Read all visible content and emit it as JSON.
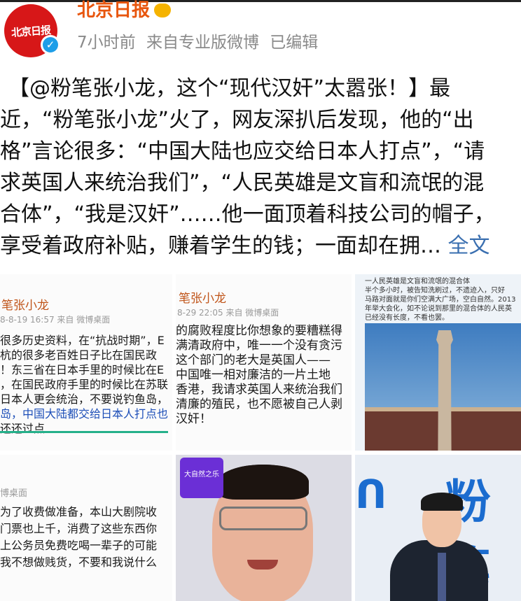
{
  "post": {
    "author": "北京日报",
    "avatar_text": "北京日报",
    "meta": "7小时前  来自专业版微博  已编辑",
    "verified_icon": "verified-check-icon",
    "lines": [
      "【@粉笔张小龙，这个“现代汉奸”太嚣张！】最",
      "近，“粉笔张小龙”火了，网友深扒后发现，他的“出",
      "格”言论很多：“中国大陆也应交给日本人打点”，“请",
      "求英国人来统治我们”，“人民英雄是文盲和流氓的混",
      "合体”，“我是汉奸”……他一面顶着科技公司的帽子，",
      "享受着政府补贴，赚着学生的钱；一面却在拥…"
    ],
    "expand_label": "全文"
  },
  "images": {
    "img1": {
      "name": "笔张小龙",
      "date": "8-8-19 16:57  来自 微博桌面",
      "lines": [
        "很多历史资料，在“抗战时期”，E",
        "杭的很多老百姓日子比在国民政",
        "！东三省在日本手里的时候比在E",
        "，在国民政府手里的时候比在苏联",
        "日本人更会统治，不要说钓鱼岛，",
        "岛，中国大陆都交给日本人打点也",
        "还还过点"
      ]
    },
    "img2": {
      "name": "笔张小龙",
      "date": "8-29 22:05  来自 微博桌面",
      "lines": [
        "的腐败程度比你想象的要糟糕得",
        "满清政府中，唯一一个没有贪污",
        "这个部门的老大是英国人——",
        "中国唯一相对廉洁的一片土地",
        "香港，我请求英国人来统治我们",
        "清廉的殖民，也不愿被自己人剥",
        "汉奸！"
      ]
    },
    "img3": {
      "caption_lines": [
        "一人民英雄是文盲和流氓的混合体",
        "半个多小时，被告知洗刷过，不遗迹入，只好",
        "马路对面就是你们空满大广场，空白自然。2013",
        "年举大会化，如不论说到那里的混合体的人民英",
        "已经没有长度，不看也罢。"
      ]
    },
    "img4": {
      "date": "博桌面",
      "lines": [
        "为了收费做准备，本山大剧院收",
        "门票也上千，消费了这些东西你",
        "上公务员免费吃喝一辈子的可能",
        "我不想做贱货，不要和我说什么"
      ]
    },
    "img5": {
      "badge": "大自然之乐"
    },
    "img6": {
      "logo_word": "粉笔"
    }
  }
}
